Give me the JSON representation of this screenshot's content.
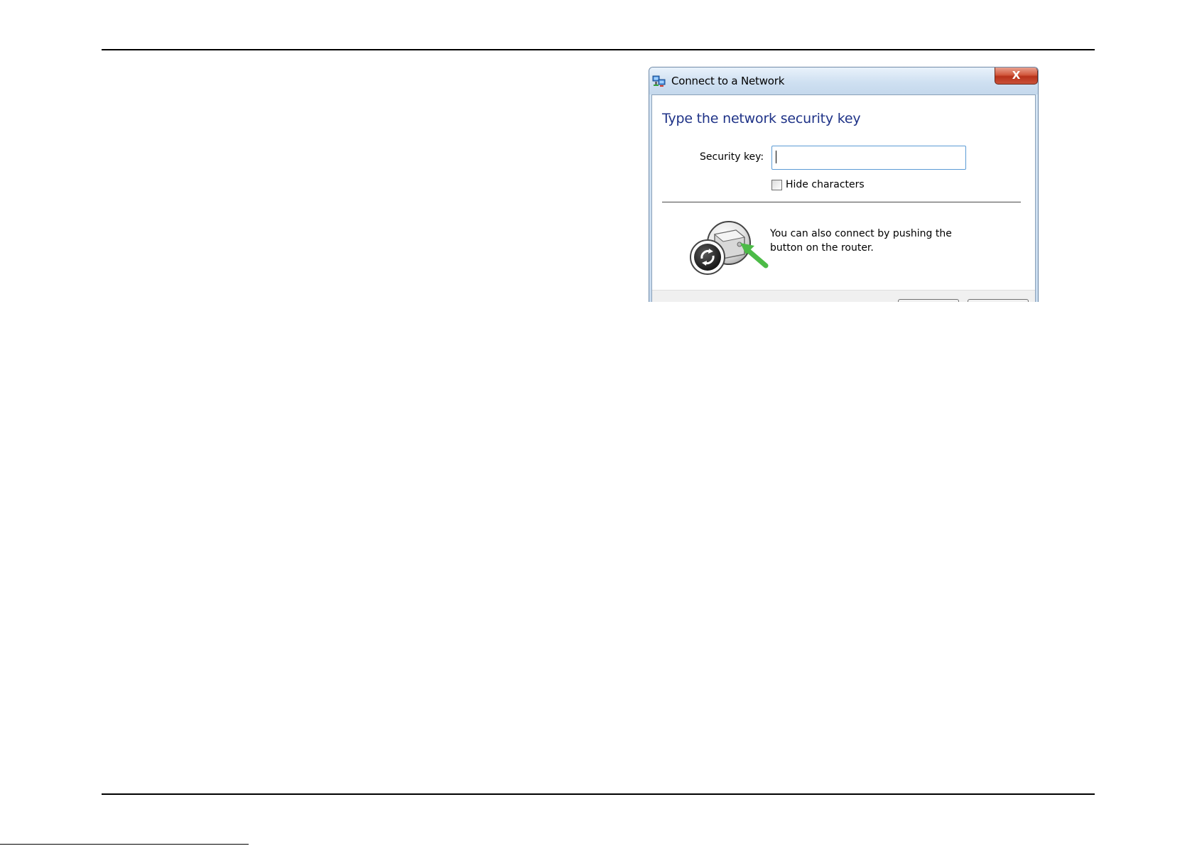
{
  "dialog": {
    "title": "Connect to a Network",
    "close_label": "X",
    "heading": "Type the network security key",
    "security_key": {
      "label": "Security key:",
      "value": "",
      "placeholder": ""
    },
    "hide_characters": {
      "label": "Hide characters",
      "checked": false
    },
    "wps_message_line1": "You can also connect by pushing the",
    "wps_message_line2": "button on the router."
  },
  "icons": {
    "title": "network-connection-icon",
    "wps": "wps-router-push-button-icon"
  },
  "colors": {
    "heading": "#1e3287",
    "close_button": "#c9452c",
    "input_border": "#5b9bd5",
    "wps_arrow": "#4cbb47"
  }
}
